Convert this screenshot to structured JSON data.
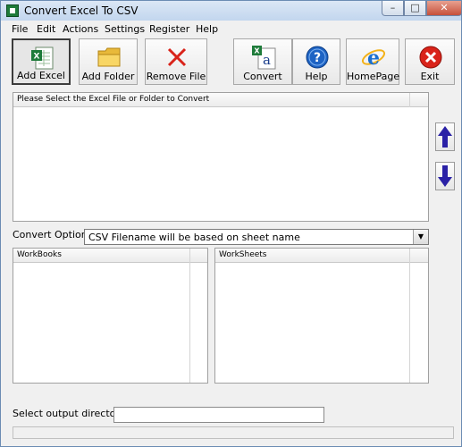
{
  "window": {
    "title": "Convert Excel To CSV"
  },
  "menu": [
    "File",
    "Edit",
    "Actions",
    "Settings",
    "Register",
    "Help"
  ],
  "toolbar": {
    "add_excel": "Add Excel",
    "add_folder": "Add Folder",
    "remove_file": "Remove File",
    "convert": "Convert",
    "help": "Help",
    "homepage": "HomePage",
    "exit": "Exit"
  },
  "file_list": {
    "header": "Please Select the Excel File or Folder to Convert"
  },
  "convert_option": {
    "label": "Convert Option:",
    "selected": "CSV Filename will be based on sheet name"
  },
  "workbooks": {
    "header": "WorkBooks"
  },
  "worksheets": {
    "header": "WorkSheets"
  },
  "output": {
    "label": "Select  output directory:",
    "value": ""
  },
  "colors": {
    "title_bg": "#c2d6ee",
    "exit_red": "#d9231a",
    "help_blue": "#1d63c4",
    "arrow_purple": "#2a21a6"
  }
}
